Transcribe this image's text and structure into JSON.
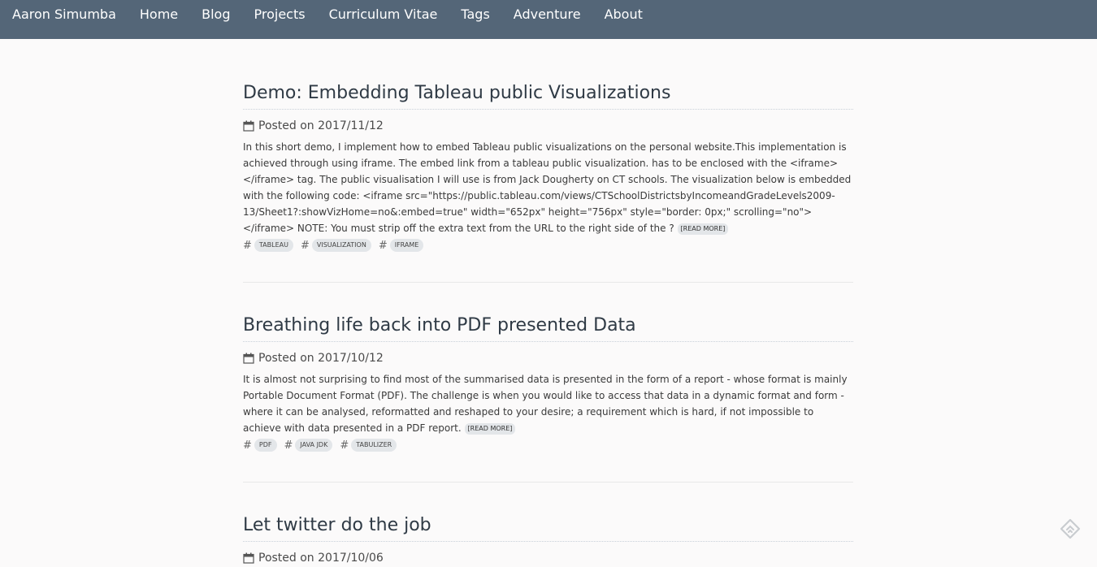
{
  "nav": {
    "brand": "Aaron Simumba",
    "items": [
      "Home",
      "Blog",
      "Projects",
      "Curriculum Vitae",
      "Tags",
      "Adventure",
      "About"
    ]
  },
  "posts": [
    {
      "title": "Demo: Embedding Tableau public Visualizations",
      "date": "Posted on 2017/11/12",
      "summary": "In this short demo, I implement how to embed Tableau public visualizations on the personal website.This implementation is achieved through using iframe. The embed link from a tableau public visualization. has to be enclosed with the <iframe> </iframe> tag. The public visualisation I will use is from Jack Dougherty on CT schools. The visualization below is embedded with the following code: <iframe src=\"https://public.tableau.com/views/CTSchoolDistrictsbyIncomeandGradeLevels2009-13/Sheet1?:showVizHome=no&:embed=true\" width=\"652px\" height=\"756px\" style=\"border: 0px;\" scrolling=\"no\"></iframe> NOTE: You must strip off the extra text from the URL to the right side of the ?",
      "readmore": "[Read More]",
      "tags": [
        "tableau",
        "visualization",
        "iframe"
      ]
    },
    {
      "title": "Breathing life back into PDF presented Data",
      "date": "Posted on 2017/10/12",
      "summary": "It is almost not surprising to find most of the summarised data is presented in the form of a report - whose format is mainly Portable Document Format (PDF). The challenge is when you would like to access that data in a dynamic format and form - where it can be analysed, reformatted and reshaped to your desire; a requirement which is hard, if not impossible to achieve with data presented in a PDF report.",
      "readmore": "[Read More]",
      "tags": [
        "pdf",
        "java jdk",
        "tabulizer"
      ]
    },
    {
      "title": "Let twitter do the job",
      "date": "Posted on 2017/10/06"
    }
  ],
  "icons": {
    "calendar": "calendar-icon",
    "feedly": "feedly-icon"
  },
  "colors": {
    "navbar": "#546678",
    "background": "#fbfafa",
    "tag_bg": "#e3e6e9"
  }
}
